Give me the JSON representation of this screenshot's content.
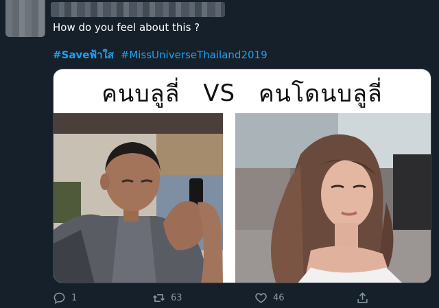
{
  "tweet": {
    "text": "How do you feel about this ?",
    "hashtags": [
      {
        "text": "#Saveฟ้าใส"
      },
      {
        "text": "#MissUniverseThailand2019"
      }
    ]
  },
  "meme": {
    "caption_left": "คนบลูลี่",
    "caption_vs": "VS",
    "caption_right": "คนโดนบลูลี่"
  },
  "actions": {
    "reply_count": "1",
    "retweet_count": "63",
    "like_count": "46"
  },
  "colors": {
    "background": "#15202b",
    "accent": "#1da1f2",
    "muted": "#8899a6"
  }
}
